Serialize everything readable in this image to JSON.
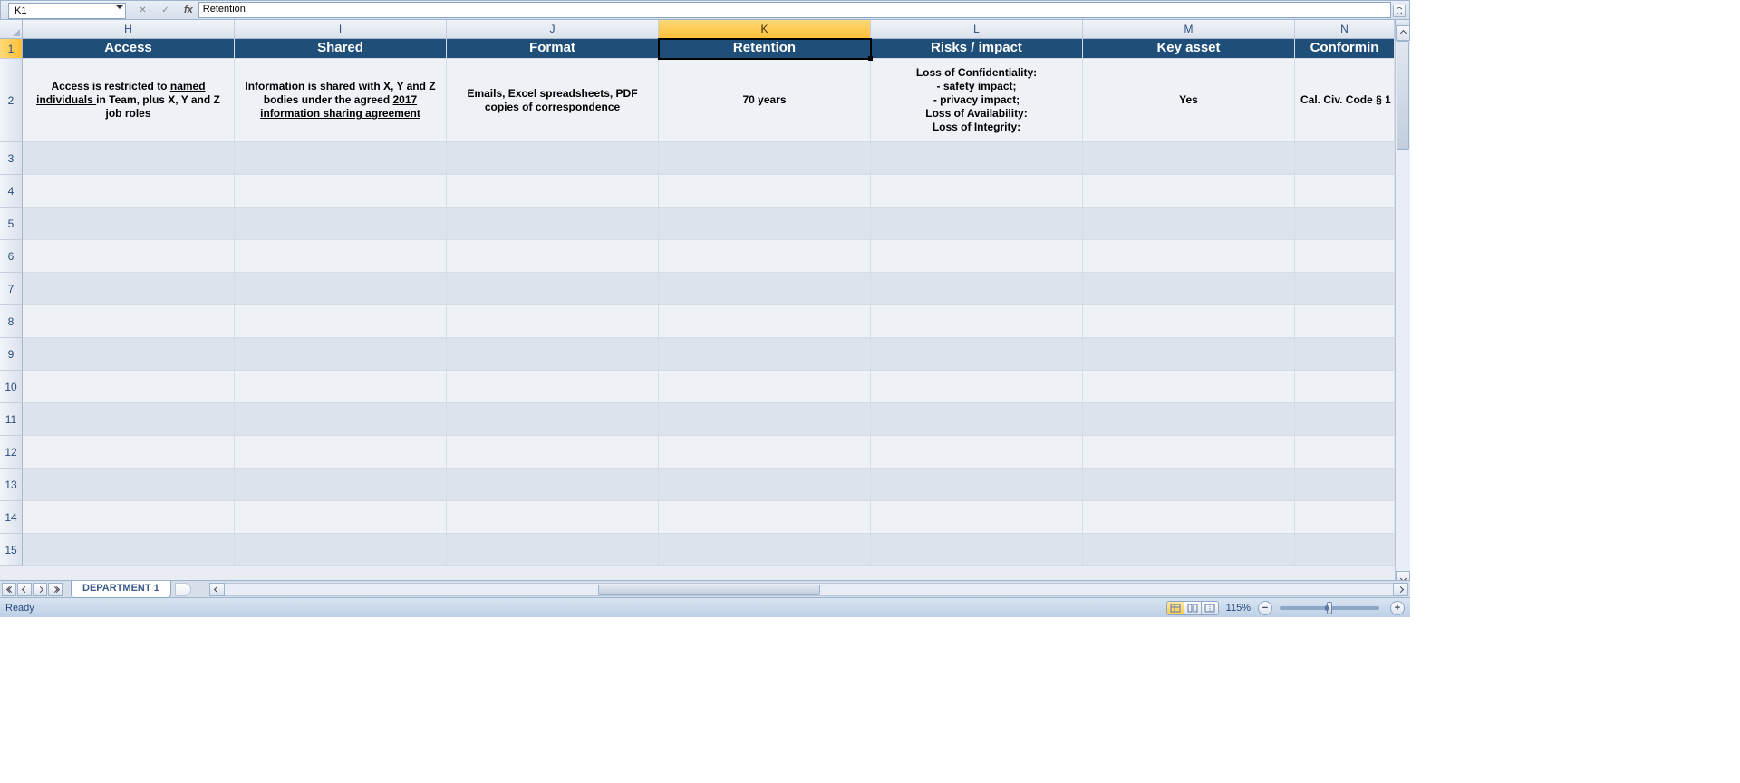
{
  "formula_bar": {
    "cell_ref": "K1",
    "fx_label": "fx",
    "value": "Retention"
  },
  "columns": [
    {
      "letter": "H",
      "label": "Access"
    },
    {
      "letter": "I",
      "label": "Shared"
    },
    {
      "letter": "J",
      "label": "Format"
    },
    {
      "letter": "K",
      "label": "Retention"
    },
    {
      "letter": "L",
      "label": "Risks / impact"
    },
    {
      "letter": "M",
      "label": "Key asset"
    },
    {
      "letter": "N",
      "label": "Conformin"
    }
  ],
  "active_col_index": 3,
  "row2": {
    "H": {
      "pre": "Access is restricted to ",
      "u": "named individuals ",
      "post": "in Team, plus X, Y and Z job roles"
    },
    "I": {
      "pre": "Information is shared with X, Y and Z bodies under the agreed ",
      "u": "2017 information sharing agreement",
      "post": ""
    },
    "J": "Emails, Excel spreadsheets, PDF copies of correspondence",
    "K": "70 years",
    "L": "Loss of Confidentiality:\n- safety impact;\n- privacy impact;\nLoss of Availability:\nLoss of Integrity:",
    "M": "Yes",
    "N": "Cal. Civ. Code § 1"
  },
  "visible_rows": 15,
  "row1_h": 22,
  "row2_h": 92,
  "rowN_h": 36,
  "sheet_tab": "DEPARTMENT 1",
  "status_text": "Ready",
  "zoom": "115%",
  "hscroll": {
    "start_pct": 32,
    "len_pct": 19
  }
}
